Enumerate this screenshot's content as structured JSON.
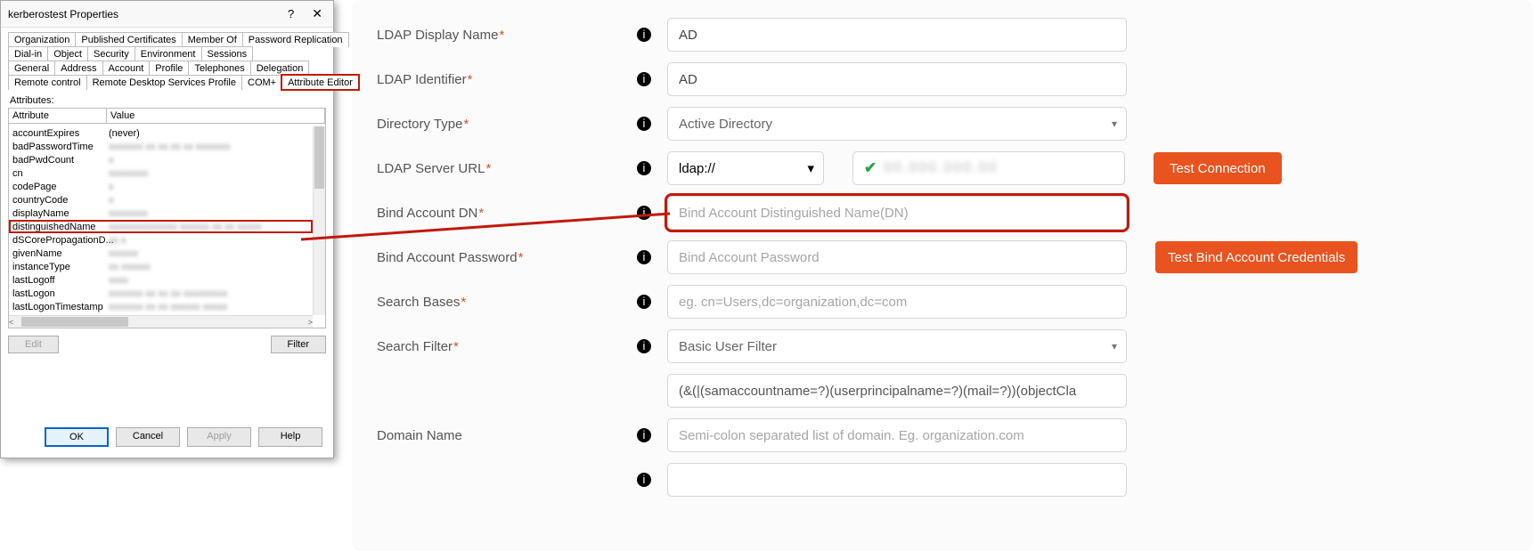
{
  "dialog": {
    "title": "kerberostest Properties",
    "tabs_row1": [
      "Organization",
      "Published Certificates",
      "Member Of",
      "Password Replication"
    ],
    "tabs_row2": [
      "Dial-in",
      "Object",
      "Security",
      "Environment",
      "Sessions"
    ],
    "tabs_row3": [
      "General",
      "Address",
      "Account",
      "Profile",
      "Telephones",
      "Delegation"
    ],
    "tabs_row4": [
      "Remote control",
      "Remote Desktop Services Profile",
      "COM+",
      "Attribute Editor"
    ],
    "attrs_label": "Attributes:",
    "head_attr": "Attribute",
    "head_val": "Value",
    "rows": [
      {
        "k": "accountExpires",
        "v": "(never)",
        "plain": true
      },
      {
        "k": "badPasswordTime",
        "v": "xxxxxxx xx xx xx xx xxxxxxx"
      },
      {
        "k": "badPwdCount",
        "v": "x"
      },
      {
        "k": "cn",
        "v": "xxxxxxxx"
      },
      {
        "k": "codePage",
        "v": "x"
      },
      {
        "k": "countryCode",
        "v": "x"
      },
      {
        "k": "displayName",
        "v": "xxxxxxxx"
      },
      {
        "k": "distinguishedName",
        "v": "xxxxxxxxxxxxxx xxxxxx xx xx xxxxx"
      },
      {
        "k": "dSCorePropagationD...",
        "v": "xx x"
      },
      {
        "k": "givenName",
        "v": "xxxxxx"
      },
      {
        "k": "instanceType",
        "v": "xx xxxxxx"
      },
      {
        "k": "lastLogoff",
        "v": "xxxx"
      },
      {
        "k": "lastLogon",
        "v": "xxxxxxx xx xx xx xxxxxxxxx"
      },
      {
        "k": "lastLogonTimestamp",
        "v": "xxxxxxx xx xx xxxxxx xxxxx"
      }
    ],
    "edit_btn": "Edit",
    "filter_btn": "Filter",
    "ok": "OK",
    "cancel": "Cancel",
    "apply": "Apply",
    "help": "Help"
  },
  "form": {
    "ldap_display_label": "LDAP Display Name",
    "ldap_display_value": "AD",
    "ldap_id_label": "LDAP Identifier",
    "ldap_id_value": "AD",
    "dir_type_label": "Directory Type",
    "dir_type_value": "Active Directory",
    "server_url_label": "LDAP Server URL",
    "protocol_value": "ldap://",
    "bind_dn_label": "Bind Account DN",
    "bind_dn_placeholder": "Bind Account Distinguished Name(DN)",
    "bind_pw_label": "Bind Account Password",
    "bind_pw_placeholder": "Bind Account Password",
    "search_bases_label": "Search Bases",
    "search_bases_placeholder": "eg. cn=Users,dc=organization,dc=com",
    "search_filter_label": "Search Filter",
    "search_filter_value": "Basic User Filter",
    "filter_string": "(&(|(samaccountname=?)(userprincipalname=?)(mail=?))(objectCla",
    "domain_label": "Domain Name",
    "domain_placeholder": "Semi-colon separated list of domain. Eg. organization.com",
    "test_conn_btn": "Test Connection",
    "test_bind_btn": "Test Bind Account Credentials"
  }
}
